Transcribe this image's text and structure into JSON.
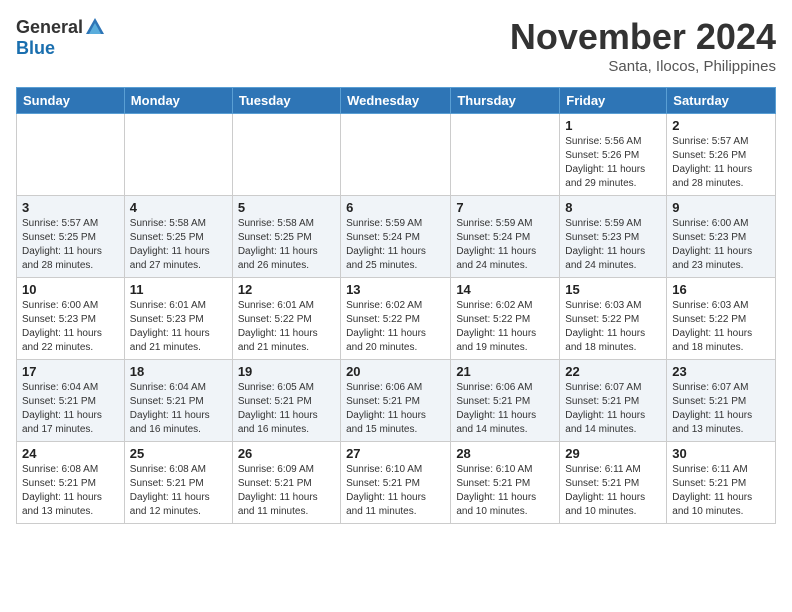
{
  "header": {
    "logo_general": "General",
    "logo_blue": "Blue",
    "month": "November 2024",
    "location": "Santa, Ilocos, Philippines"
  },
  "weekdays": [
    "Sunday",
    "Monday",
    "Tuesday",
    "Wednesday",
    "Thursday",
    "Friday",
    "Saturday"
  ],
  "weeks": [
    [
      {
        "day": "",
        "info": ""
      },
      {
        "day": "",
        "info": ""
      },
      {
        "day": "",
        "info": ""
      },
      {
        "day": "",
        "info": ""
      },
      {
        "day": "",
        "info": ""
      },
      {
        "day": "1",
        "info": "Sunrise: 5:56 AM\nSunset: 5:26 PM\nDaylight: 11 hours and 29 minutes."
      },
      {
        "day": "2",
        "info": "Sunrise: 5:57 AM\nSunset: 5:26 PM\nDaylight: 11 hours and 28 minutes."
      }
    ],
    [
      {
        "day": "3",
        "info": "Sunrise: 5:57 AM\nSunset: 5:25 PM\nDaylight: 11 hours and 28 minutes."
      },
      {
        "day": "4",
        "info": "Sunrise: 5:58 AM\nSunset: 5:25 PM\nDaylight: 11 hours and 27 minutes."
      },
      {
        "day": "5",
        "info": "Sunrise: 5:58 AM\nSunset: 5:25 PM\nDaylight: 11 hours and 26 minutes."
      },
      {
        "day": "6",
        "info": "Sunrise: 5:59 AM\nSunset: 5:24 PM\nDaylight: 11 hours and 25 minutes."
      },
      {
        "day": "7",
        "info": "Sunrise: 5:59 AM\nSunset: 5:24 PM\nDaylight: 11 hours and 24 minutes."
      },
      {
        "day": "8",
        "info": "Sunrise: 5:59 AM\nSunset: 5:23 PM\nDaylight: 11 hours and 24 minutes."
      },
      {
        "day": "9",
        "info": "Sunrise: 6:00 AM\nSunset: 5:23 PM\nDaylight: 11 hours and 23 minutes."
      }
    ],
    [
      {
        "day": "10",
        "info": "Sunrise: 6:00 AM\nSunset: 5:23 PM\nDaylight: 11 hours and 22 minutes."
      },
      {
        "day": "11",
        "info": "Sunrise: 6:01 AM\nSunset: 5:23 PM\nDaylight: 11 hours and 21 minutes."
      },
      {
        "day": "12",
        "info": "Sunrise: 6:01 AM\nSunset: 5:22 PM\nDaylight: 11 hours and 21 minutes."
      },
      {
        "day": "13",
        "info": "Sunrise: 6:02 AM\nSunset: 5:22 PM\nDaylight: 11 hours and 20 minutes."
      },
      {
        "day": "14",
        "info": "Sunrise: 6:02 AM\nSunset: 5:22 PM\nDaylight: 11 hours and 19 minutes."
      },
      {
        "day": "15",
        "info": "Sunrise: 6:03 AM\nSunset: 5:22 PM\nDaylight: 11 hours and 18 minutes."
      },
      {
        "day": "16",
        "info": "Sunrise: 6:03 AM\nSunset: 5:22 PM\nDaylight: 11 hours and 18 minutes."
      }
    ],
    [
      {
        "day": "17",
        "info": "Sunrise: 6:04 AM\nSunset: 5:21 PM\nDaylight: 11 hours and 17 minutes."
      },
      {
        "day": "18",
        "info": "Sunrise: 6:04 AM\nSunset: 5:21 PM\nDaylight: 11 hours and 16 minutes."
      },
      {
        "day": "19",
        "info": "Sunrise: 6:05 AM\nSunset: 5:21 PM\nDaylight: 11 hours and 16 minutes."
      },
      {
        "day": "20",
        "info": "Sunrise: 6:06 AM\nSunset: 5:21 PM\nDaylight: 11 hours and 15 minutes."
      },
      {
        "day": "21",
        "info": "Sunrise: 6:06 AM\nSunset: 5:21 PM\nDaylight: 11 hours and 14 minutes."
      },
      {
        "day": "22",
        "info": "Sunrise: 6:07 AM\nSunset: 5:21 PM\nDaylight: 11 hours and 14 minutes."
      },
      {
        "day": "23",
        "info": "Sunrise: 6:07 AM\nSunset: 5:21 PM\nDaylight: 11 hours and 13 minutes."
      }
    ],
    [
      {
        "day": "24",
        "info": "Sunrise: 6:08 AM\nSunset: 5:21 PM\nDaylight: 11 hours and 13 minutes."
      },
      {
        "day": "25",
        "info": "Sunrise: 6:08 AM\nSunset: 5:21 PM\nDaylight: 11 hours and 12 minutes."
      },
      {
        "day": "26",
        "info": "Sunrise: 6:09 AM\nSunset: 5:21 PM\nDaylight: 11 hours and 11 minutes."
      },
      {
        "day": "27",
        "info": "Sunrise: 6:10 AM\nSunset: 5:21 PM\nDaylight: 11 hours and 11 minutes."
      },
      {
        "day": "28",
        "info": "Sunrise: 6:10 AM\nSunset: 5:21 PM\nDaylight: 11 hours and 10 minutes."
      },
      {
        "day": "29",
        "info": "Sunrise: 6:11 AM\nSunset: 5:21 PM\nDaylight: 11 hours and 10 minutes."
      },
      {
        "day": "30",
        "info": "Sunrise: 6:11 AM\nSunset: 5:21 PM\nDaylight: 11 hours and 10 minutes."
      }
    ]
  ]
}
